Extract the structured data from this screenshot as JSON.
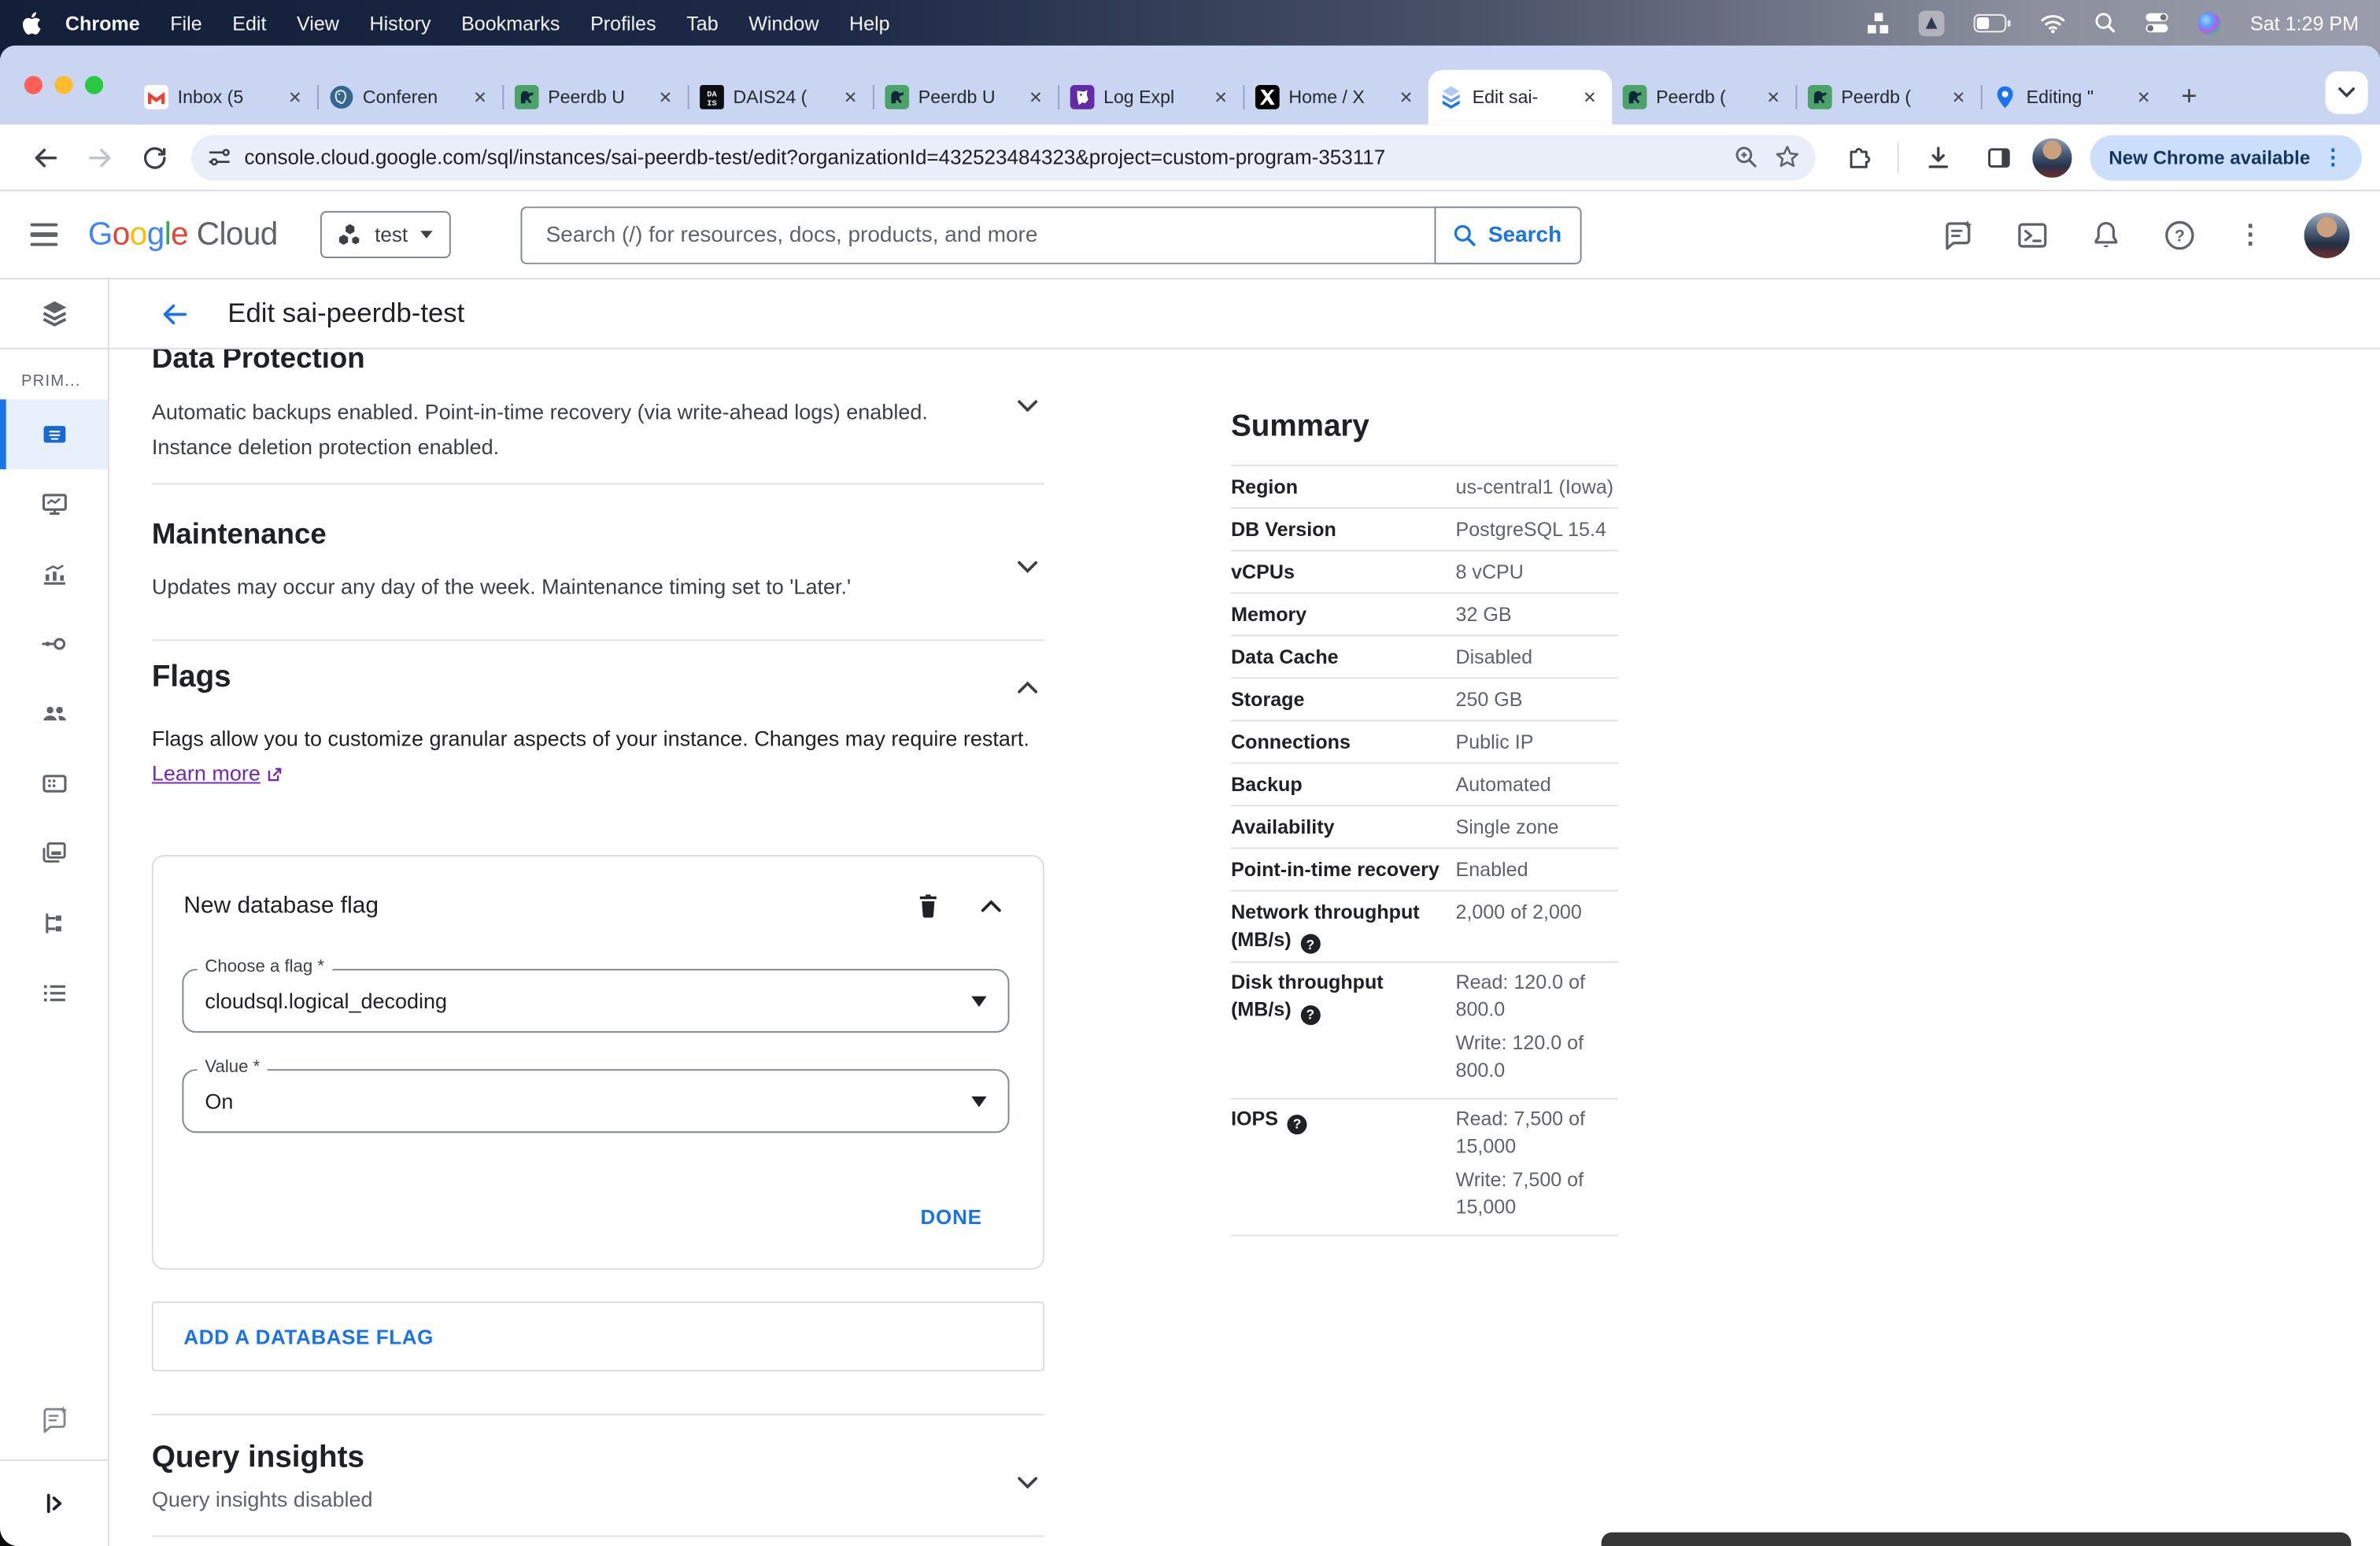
{
  "menubar": {
    "items": [
      "Chrome",
      "File",
      "Edit",
      "View",
      "History",
      "Bookmarks",
      "Profiles",
      "Tab",
      "Window",
      "Help"
    ],
    "clock": "Sat 1:29 PM"
  },
  "tabs": [
    {
      "title": "Inbox (5",
      "favicon": "gmail"
    },
    {
      "title": "Conferen",
      "favicon": "postgres"
    },
    {
      "title": "Peerdb U",
      "favicon": "peerdb"
    },
    {
      "title": "DAIS24 (",
      "favicon": "dais"
    },
    {
      "title": "Peerdb U",
      "favicon": "peerdb"
    },
    {
      "title": "Log Expl",
      "favicon": "datadog"
    },
    {
      "title": "Home / X",
      "favicon": "x"
    },
    {
      "title": "Edit sai-",
      "favicon": "cloudsql",
      "active": true
    },
    {
      "title": "Peerdb (",
      "favicon": "peerdb"
    },
    {
      "title": "Peerdb (",
      "favicon": "peerdb"
    },
    {
      "title": "Editing \"",
      "favicon": "mapspin"
    }
  ],
  "toolbar": {
    "url": "console.cloud.google.com/sql/instances/sai-peerdb-test/edit?organizationId=432523484323&project=custom-program-353117",
    "update_button": "New Chrome available"
  },
  "gc_header": {
    "logo_google": "Google",
    "logo_cloud": " Cloud",
    "project": "test",
    "search_placeholder": "Search (/) for resources, docs, products, and more",
    "search_button": "Search"
  },
  "sidebar": {
    "group_label": "PRIM...",
    "items": [
      {
        "name": "overview",
        "active": true
      },
      {
        "name": "system-insights"
      },
      {
        "name": "query-insights"
      },
      {
        "name": "connections"
      },
      {
        "name": "users"
      },
      {
        "name": "databases"
      },
      {
        "name": "backups"
      },
      {
        "name": "replicas"
      },
      {
        "name": "operations"
      }
    ]
  },
  "page": {
    "title": "Edit sai-peerdb-test"
  },
  "sections": {
    "data_protection": {
      "title": "Data Protection",
      "lines": [
        "Automatic backups enabled. Point-in-time recovery (via write-ahead logs) enabled.",
        "Instance deletion protection enabled."
      ]
    },
    "maintenance": {
      "title": "Maintenance",
      "desc": "Updates may occur any day of the week. Maintenance timing set to 'Later.'"
    },
    "flags": {
      "title": "Flags",
      "desc": "Flags allow you to customize granular aspects of your instance. Changes may require restart.",
      "link": "Learn more"
    },
    "flag_card": {
      "title": "New database flag",
      "choose_label": "Choose a flag *",
      "choose_value": "cloudsql.logical_decoding",
      "value_label": "Value *",
      "value_value": "On",
      "done": "DONE"
    },
    "add_flag": "ADD A DATABASE FLAG",
    "query_insights": {
      "title": "Query insights",
      "status": "Query insights disabled"
    }
  },
  "summary": {
    "title": "Summary",
    "rows": [
      {
        "label": "Region",
        "value": "us-central1 (Iowa)"
      },
      {
        "label": "DB Version",
        "value": "PostgreSQL 15.4"
      },
      {
        "label": "vCPUs",
        "value": "8 vCPU"
      },
      {
        "label": "Memory",
        "value": "32 GB"
      },
      {
        "label": "Data Cache",
        "value": "Disabled"
      },
      {
        "label": "Storage",
        "value": "250 GB"
      },
      {
        "label": "Connections",
        "value": "Public IP"
      },
      {
        "label": "Backup",
        "value": "Automated"
      },
      {
        "label": "Availability",
        "value": "Single zone"
      },
      {
        "label": "Point-in-time recovery",
        "value": "Enabled"
      },
      {
        "label": "Network throughput (MB/s)",
        "help": true,
        "value": "2,000 of 2,000"
      },
      {
        "label": "Disk throughput (MB/s)",
        "help": true,
        "values": [
          "Read: 120.0 of 800.0",
          "Write: 120.0 of 800.0"
        ]
      },
      {
        "label": "IOPS",
        "help": true,
        "values": [
          "Read: 7,500 of 15,000",
          "Write: 7,500 of 15,000"
        ]
      }
    ]
  }
}
